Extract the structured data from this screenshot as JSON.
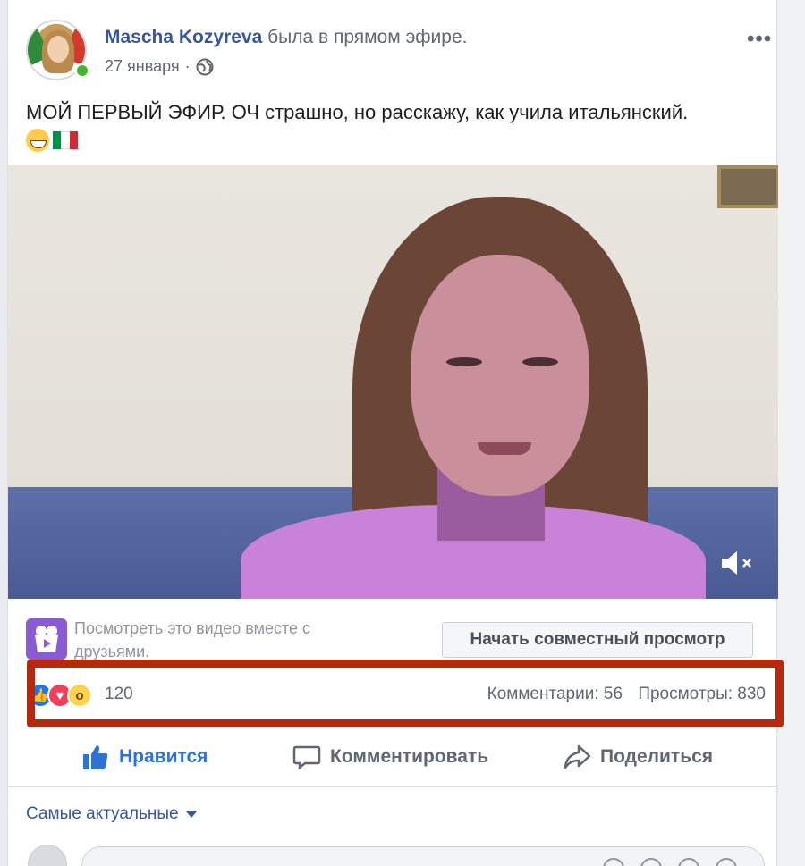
{
  "post": {
    "author": "Mascha Kozyreva",
    "action": "была в прямом эфире.",
    "date": "27 января",
    "separator": "·",
    "text": "МОЙ ПЕРВЫЙ ЭФИР. ОЧ страшно, но расскажу, как учила итальянский.",
    "more": "•••"
  },
  "watch_party": {
    "text": "Посмотреть это видео вместе с друзьями.",
    "button": "Начать совместный просмотр"
  },
  "stats": {
    "reactions_count": "120",
    "comments": "Комментарии: 56",
    "views": "Просмотры: 830"
  },
  "actions": {
    "like": "Нравится",
    "comment": "Комментировать",
    "share": "Поделиться"
  },
  "comments": {
    "sort_label": "Самые актуальные"
  },
  "colors": {
    "link": "#385898",
    "like_active": "#2d73d7",
    "highlight": "#b52a0e",
    "online": "#42b72a"
  }
}
